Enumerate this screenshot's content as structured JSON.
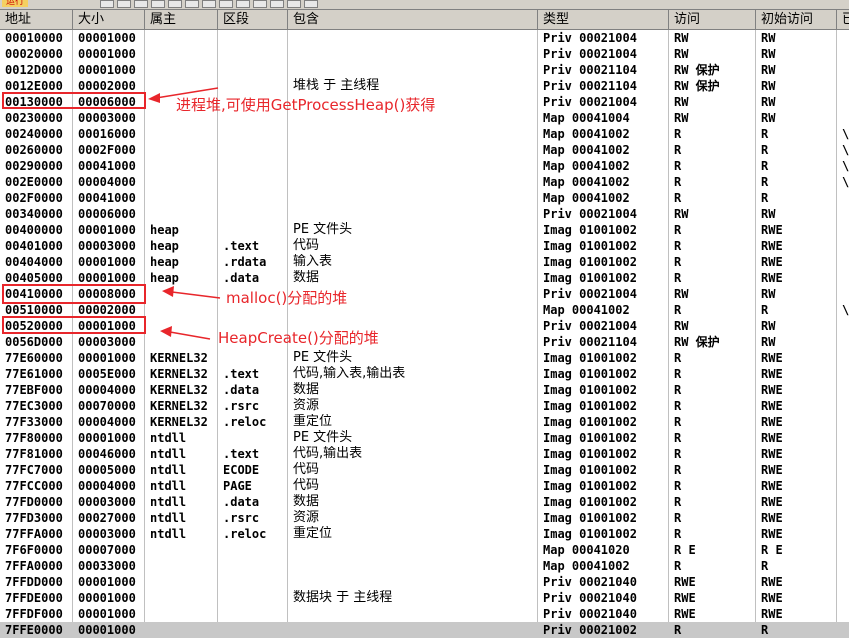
{
  "toolbar": {
    "title": "运行",
    "buttons": [
      "L",
      "E",
      "M",
      "T",
      "W",
      "H",
      "C",
      "/",
      "K",
      "B",
      "R",
      "...",
      "S"
    ]
  },
  "columns": [
    "地址",
    "大小",
    "属主",
    "区段",
    "包含",
    "类型",
    "访问",
    "初始访问",
    "已"
  ],
  "rows": [
    [
      "00010000",
      "00001000",
      "",
      "",
      "",
      "Priv  00021004",
      "RW",
      "RW",
      ""
    ],
    [
      "00020000",
      "00001000",
      "",
      "",
      "",
      "Priv  00021004",
      "RW",
      "RW",
      ""
    ],
    [
      "0012D000",
      "00001000",
      "",
      "",
      "",
      "Priv  00021104",
      "RW  保护",
      "RW",
      ""
    ],
    [
      "0012E000",
      "00002000",
      "",
      "",
      "堆栈 于  主线程",
      "Priv  00021104",
      "RW  保护",
      "RW",
      ""
    ],
    [
      "00130000",
      "00006000",
      "",
      "",
      "",
      "Priv  00021004",
      "RW",
      "RW",
      ""
    ],
    [
      "00230000",
      "00003000",
      "",
      "",
      "",
      "Map   00041004",
      "RW",
      "RW",
      ""
    ],
    [
      "00240000",
      "00016000",
      "",
      "",
      "",
      "Map   00041002",
      "R",
      "R",
      "\\"
    ],
    [
      "00260000",
      "0002F000",
      "",
      "",
      "",
      "Map   00041002",
      "R",
      "R",
      "\\"
    ],
    [
      "00290000",
      "00041000",
      "",
      "",
      "",
      "Map   00041002",
      "R",
      "R",
      "\\"
    ],
    [
      "002E0000",
      "00004000",
      "",
      "",
      "",
      "Map   00041002",
      "R",
      "R",
      "\\"
    ],
    [
      "002F0000",
      "00041000",
      "",
      "",
      "",
      "Map   00041002",
      "R",
      "R",
      ""
    ],
    [
      "00340000",
      "00006000",
      "",
      "",
      "",
      "Priv  00021004",
      "RW",
      "RW",
      ""
    ],
    [
      "00400000",
      "00001000",
      "heap",
      "",
      "PE 文件头",
      "Imag  01001002",
      "R",
      "RWE",
      ""
    ],
    [
      "00401000",
      "00003000",
      "heap",
      ".text",
      "代码",
      "Imag  01001002",
      "R",
      "RWE",
      ""
    ],
    [
      "00404000",
      "00001000",
      "heap",
      ".rdata",
      "输入表",
      "Imag  01001002",
      "R",
      "RWE",
      ""
    ],
    [
      "00405000",
      "00001000",
      "heap",
      ".data",
      "数据",
      "Imag  01001002",
      "R",
      "RWE",
      ""
    ],
    [
      "00410000",
      "00008000",
      "",
      "",
      "",
      "Priv  00021004",
      "RW",
      "RW",
      ""
    ],
    [
      "00510000",
      "00002000",
      "",
      "",
      "",
      "Map   00041002",
      "R",
      "R",
      "\\"
    ],
    [
      "00520000",
      "00001000",
      "",
      "",
      "",
      "Priv  00021004",
      "RW",
      "RW",
      ""
    ],
    [
      "0056D000",
      "00003000",
      "",
      "",
      "",
      "Priv  00021104",
      "RW  保护",
      "RW",
      ""
    ],
    [
      "77E60000",
      "00001000",
      "KERNEL32",
      "",
      "PE 文件头",
      "Imag  01001002",
      "R",
      "RWE",
      ""
    ],
    [
      "77E61000",
      "0005E000",
      "KERNEL32",
      ".text",
      "代码,输入表,输出表",
      "Imag  01001002",
      "R",
      "RWE",
      ""
    ],
    [
      "77EBF000",
      "00004000",
      "KERNEL32",
      ".data",
      "数据",
      "Imag  01001002",
      "R",
      "RWE",
      ""
    ],
    [
      "77EC3000",
      "00070000",
      "KERNEL32",
      ".rsrc",
      "资源",
      "Imag  01001002",
      "R",
      "RWE",
      ""
    ],
    [
      "77F33000",
      "00004000",
      "KERNEL32",
      ".reloc",
      "重定位",
      "Imag  01001002",
      "R",
      "RWE",
      ""
    ],
    [
      "77F80000",
      "00001000",
      "ntdll",
      "",
      "PE 文件头",
      "Imag  01001002",
      "R",
      "RWE",
      ""
    ],
    [
      "77F81000",
      "00046000",
      "ntdll",
      ".text",
      "代码,输出表",
      "Imag  01001002",
      "R",
      "RWE",
      ""
    ],
    [
      "77FC7000",
      "00005000",
      "ntdll",
      "ECODE",
      "代码",
      "Imag  01001002",
      "R",
      "RWE",
      ""
    ],
    [
      "77FCC000",
      "00004000",
      "ntdll",
      "PAGE",
      "代码",
      "Imag  01001002",
      "R",
      "RWE",
      ""
    ],
    [
      "77FD0000",
      "00003000",
      "ntdll",
      ".data",
      "数据",
      "Imag  01001002",
      "R",
      "RWE",
      ""
    ],
    [
      "77FD3000",
      "00027000",
      "ntdll",
      ".rsrc",
      "资源",
      "Imag  01001002",
      "R",
      "RWE",
      ""
    ],
    [
      "77FFA000",
      "00003000",
      "ntdll",
      ".reloc",
      "重定位",
      "Imag  01001002",
      "R",
      "RWE",
      ""
    ],
    [
      "7F6F0000",
      "00007000",
      "",
      "",
      "",
      "Map   00041020",
      "R E",
      "R E",
      ""
    ],
    [
      "7FFA0000",
      "00033000",
      "",
      "",
      "",
      "Map   00041002",
      "R",
      "R",
      ""
    ],
    [
      "7FFDD000",
      "00001000",
      "",
      "",
      "",
      "Priv  00021040",
      "RWE",
      "RWE",
      ""
    ],
    [
      "7FFDE000",
      "00001000",
      "",
      "",
      "数据块 于  主线程",
      "Priv  00021040",
      "RWE",
      "RWE",
      ""
    ],
    [
      "7FFDF000",
      "00001000",
      "",
      "",
      "",
      "Priv  00021040",
      "RWE",
      "RWE",
      ""
    ],
    [
      "7FFE0000",
      "00001000",
      "",
      "",
      "",
      "Priv  00021002",
      "R",
      "R",
      ""
    ]
  ],
  "annotations": {
    "process_heap": "进程堆,可使用GetProcessHeap()获得",
    "malloc_heap": "malloc()分配的堆",
    "heapcreate_heap": "HeapCreate()分配的堆"
  },
  "colors": {
    "annotation": "#e8262b",
    "header_bg": "#d4d0c8",
    "selected_row_bg": "#c8c8c8"
  }
}
